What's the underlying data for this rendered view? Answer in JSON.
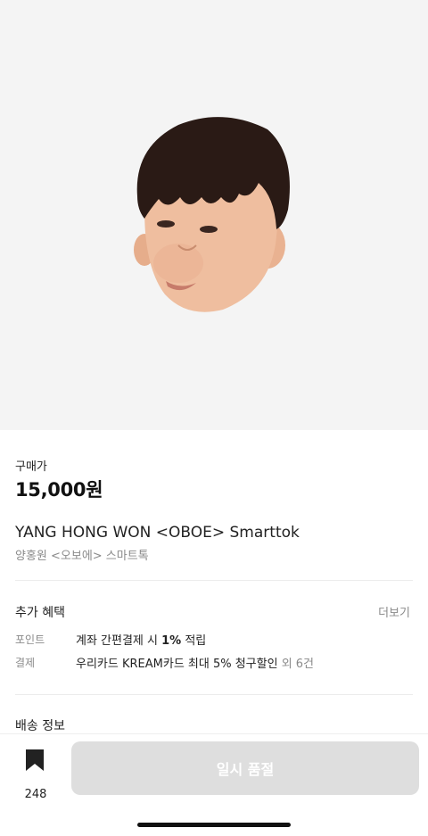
{
  "product": {
    "price_label": "구매가",
    "price": "15,000원",
    "title_en": "YANG HONG WON <OBOE> Smarttok",
    "title_ko": "양홍원 <오보에> 스마트톡"
  },
  "benefits": {
    "title": "추가 혜택",
    "more": "더보기",
    "rows": [
      {
        "key": "포인트",
        "pre": "계좌 간편결제 시 ",
        "bold": "1%",
        "post": " 적립"
      },
      {
        "key": "결제",
        "text": "우리카드 KREAM카드 최대 5% 청구할인",
        "extra": " 외 6건"
      }
    ]
  },
  "shipping": {
    "title": "배송 정보"
  },
  "bottom": {
    "wish_count": "248",
    "buy_label": "일시 품절"
  },
  "icons": {
    "wish": "bookmark-icon"
  },
  "colors": {
    "image_bg": "#f4f4f4",
    "disabled_button": "#dedede",
    "muted_text": "#8a8a8a"
  }
}
